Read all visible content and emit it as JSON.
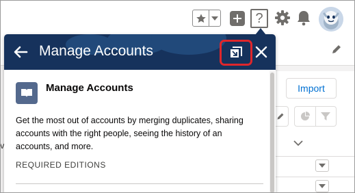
{
  "colors": {
    "header_bg": "#16325c",
    "highlight": "#e0262b",
    "link": "#0070d2",
    "icon_gray": "#706e6b"
  },
  "topbar": {
    "help_glyph": "?",
    "icons": [
      "star-icon",
      "chevron-down-icon",
      "plus-icon",
      "help-icon",
      "gear-icon",
      "bell-icon",
      "avatar"
    ]
  },
  "background_page": {
    "import_label": "Import",
    "left_edge_text": "v"
  },
  "popover": {
    "title": "Manage Accounts",
    "article": {
      "title": "Manage Accounts",
      "description": "Get the most out of accounts by merging duplicates, sharing accounts with the right people, seeing the history of an accounts, and more.",
      "section_label": "REQUIRED EDITIONS"
    }
  }
}
